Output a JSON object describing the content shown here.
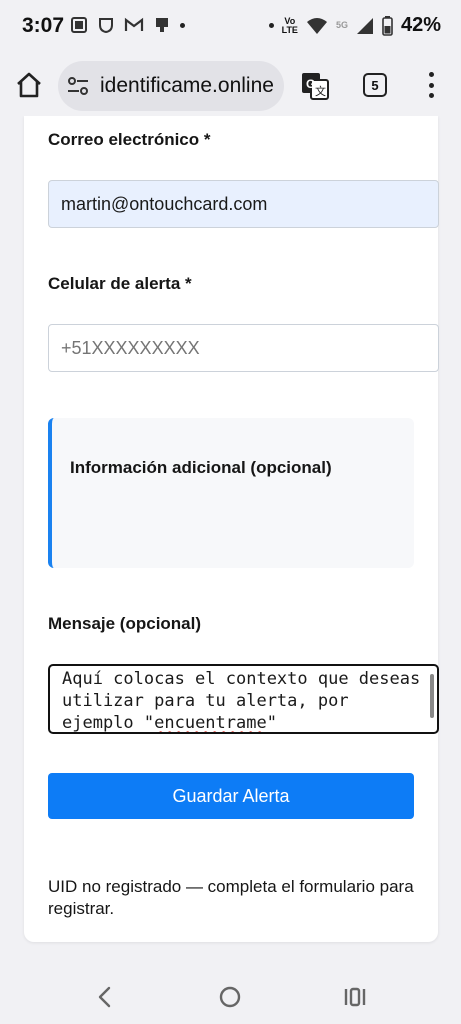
{
  "status_bar": {
    "time": "3:07",
    "battery_percent": "42%",
    "network_label": "LTE",
    "volte_label": "Vo",
    "fiveg_label": "5G"
  },
  "toolbar": {
    "url": "identificame.online",
    "tab_count": "5"
  },
  "form": {
    "email_label": "Correo electrónico *",
    "email_value": "martin@ontouchcard.com",
    "phone_label": "Celular de alerta *",
    "phone_placeholder": "+51XXXXXXXXX",
    "info_title": "Información adicional (opcional)",
    "message_label": "Mensaje (opcional)",
    "message_text_part1": "Aquí colocas el contexto que deseas utilizar para tu alerta, por ejemplo \"",
    "message_text_misspelled": "encuentrame",
    "message_text_part2": "\"",
    "save_button_label": "Guardar Alerta",
    "status_message": "UID no registrado — completa el formulario para registrar."
  },
  "colors": {
    "primary_button": "#0d7cf6",
    "info_accent": "#1a82f0",
    "autofill_bg": "#e8f0fe"
  },
  "icons": [
    "home-icon",
    "site-settings-icon",
    "translate-icon",
    "tabs-icon",
    "more-menu-icon",
    "back-icon",
    "home-circle-icon",
    "recent-apps-icon",
    "wifi-icon",
    "signal-icon",
    "battery-icon"
  ]
}
